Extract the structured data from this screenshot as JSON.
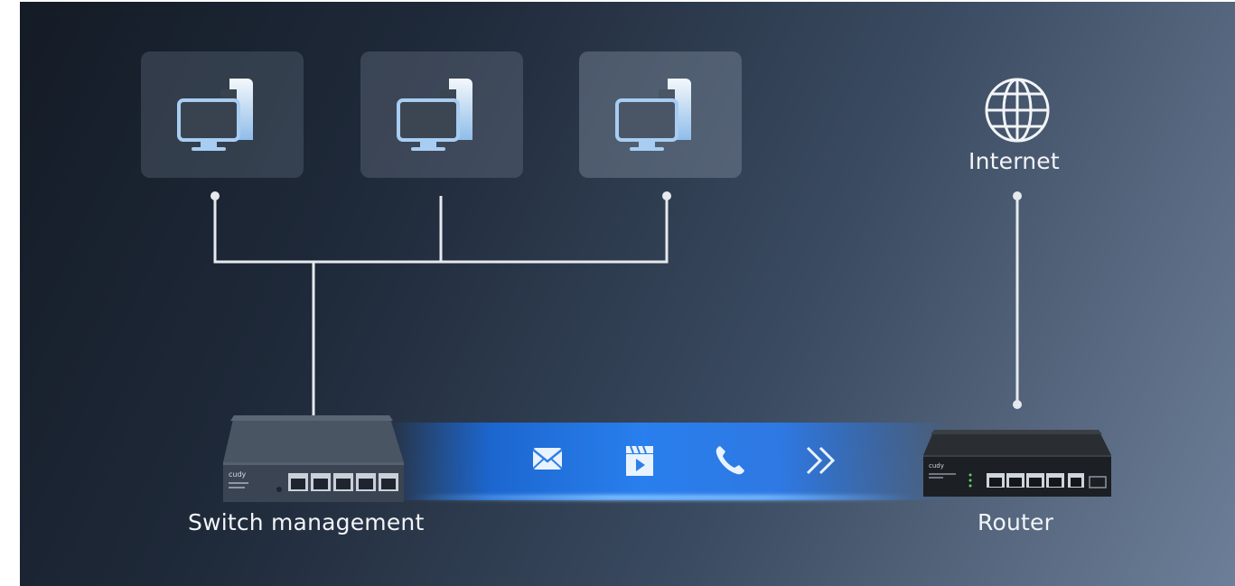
{
  "labels": {
    "internet": "Internet",
    "switch": "Switch management",
    "router": "Router"
  },
  "devices": {
    "switch_brand": "cudy",
    "router_brand": "cudy"
  },
  "icons": [
    "computer-icon",
    "computer-icon",
    "computer-icon",
    "globe-icon",
    "mail-icon",
    "video-icon",
    "phone-icon",
    "forward-icon"
  ],
  "colors": {
    "background_dark": "#141b26",
    "background_light": "#6d7f98",
    "wire": "#e8ebef",
    "beam": "#2882f5",
    "icon_light": "#ffffff",
    "icon_blue": "#a8cdf2"
  }
}
